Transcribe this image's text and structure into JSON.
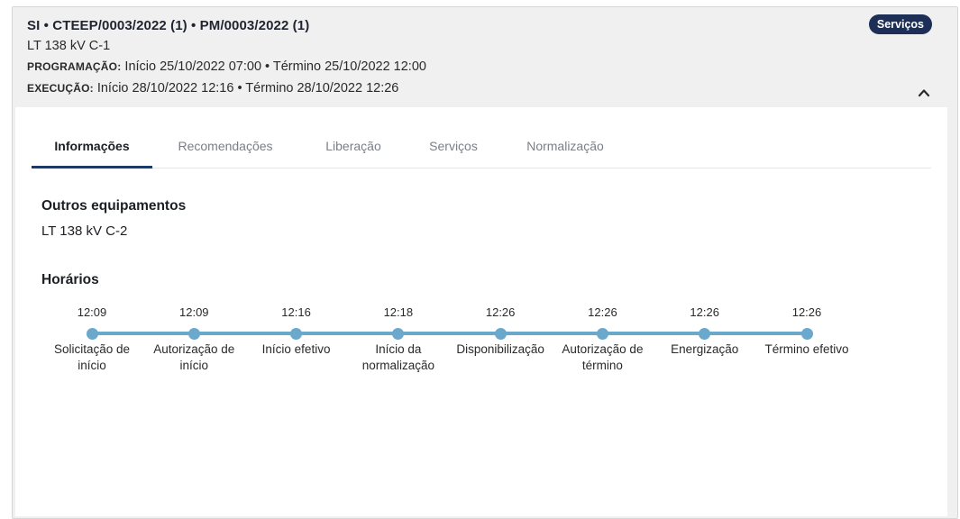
{
  "header": {
    "title": "SI • CTEEP/0003/2022 (1) • PM/0003/2022 (1)",
    "subtitle": "LT 138 kV C-1",
    "programacao_label": "PROGRAMAÇÃO:",
    "programacao_value": " Início 25/10/2022 07:00 • Término 25/10/2022 12:00",
    "execucao_label": "EXECUÇÃO:",
    "execucao_value": " Início 28/10/2022 12:16 • Término 28/10/2022 12:26",
    "badge": "Serviços",
    "collapse_icon": "chevron-up-icon"
  },
  "tabs": [
    {
      "label": "Informações",
      "active": true
    },
    {
      "label": "Recomendações",
      "active": false
    },
    {
      "label": "Liberação",
      "active": false
    },
    {
      "label": "Serviços",
      "active": false
    },
    {
      "label": "Normalização",
      "active": false
    }
  ],
  "outros": {
    "title": "Outros equipamentos",
    "value": "LT 138 kV C-2"
  },
  "horarios": {
    "title": "Horários",
    "steps": [
      {
        "time": "12:09",
        "label": "Solicitação de início"
      },
      {
        "time": "12:09",
        "label": "Autorização de início"
      },
      {
        "time": "12:16",
        "label": "Início efetivo"
      },
      {
        "time": "12:18",
        "label": "Início da normalização"
      },
      {
        "time": "12:26",
        "label": "Disponibilização"
      },
      {
        "time": "12:26",
        "label": "Autorização de término"
      },
      {
        "time": "12:26",
        "label": "Energização"
      },
      {
        "time": "12:26",
        "label": "Término efetivo"
      }
    ]
  },
  "colors": {
    "badge_bg": "#1d2f57",
    "timeline": "#6aa8cc",
    "tab_underline": "#1d3a66"
  }
}
